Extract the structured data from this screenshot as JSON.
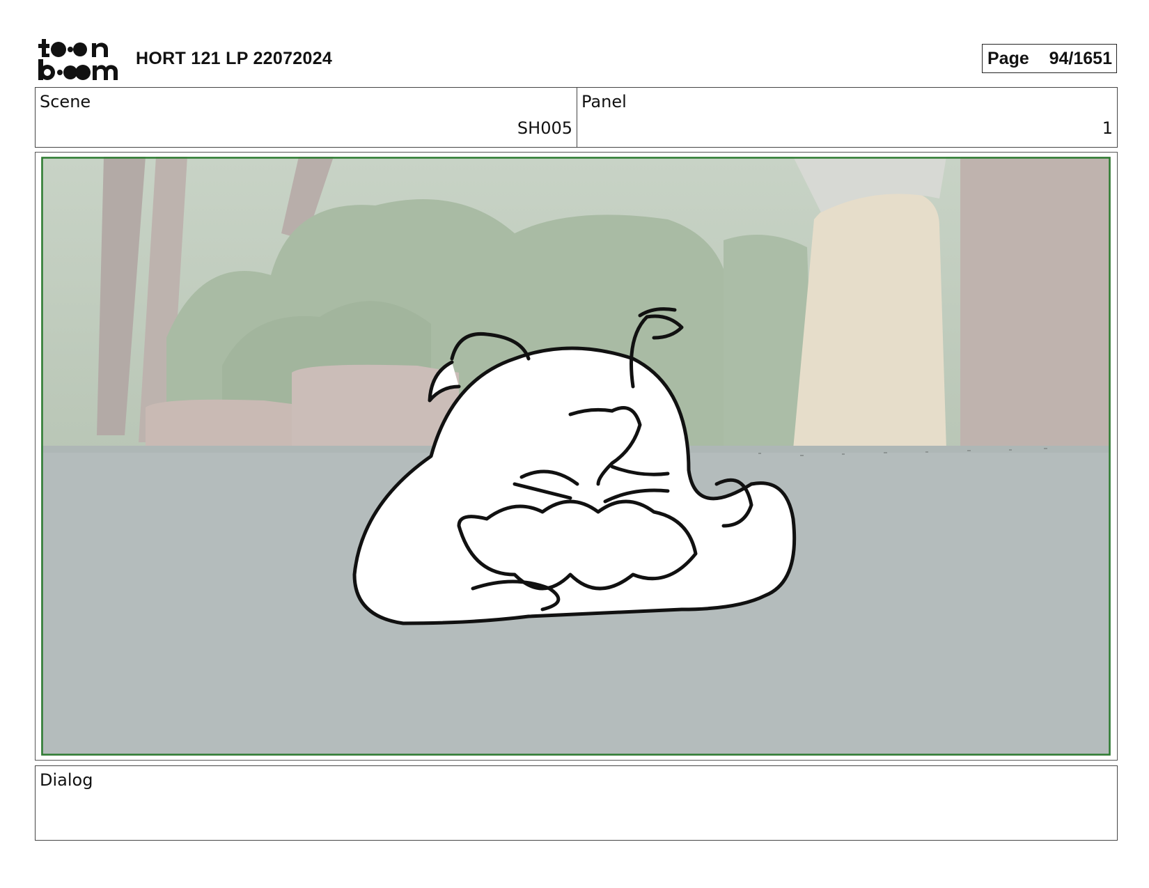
{
  "header": {
    "logo_text": "toon boom",
    "title": "HORT 121 LP 22072024",
    "page_label": "Page",
    "page_value": "94/1651"
  },
  "info": {
    "scene_label": "Scene",
    "scene_value": "SH005",
    "panel_label": "Panel",
    "panel_value": "1"
  },
  "panel_image": {
    "icon": "storyboard-drawing-sleeping-creature",
    "frame_color": "#2e7d32"
  },
  "dialog": {
    "label": "Dialog"
  }
}
